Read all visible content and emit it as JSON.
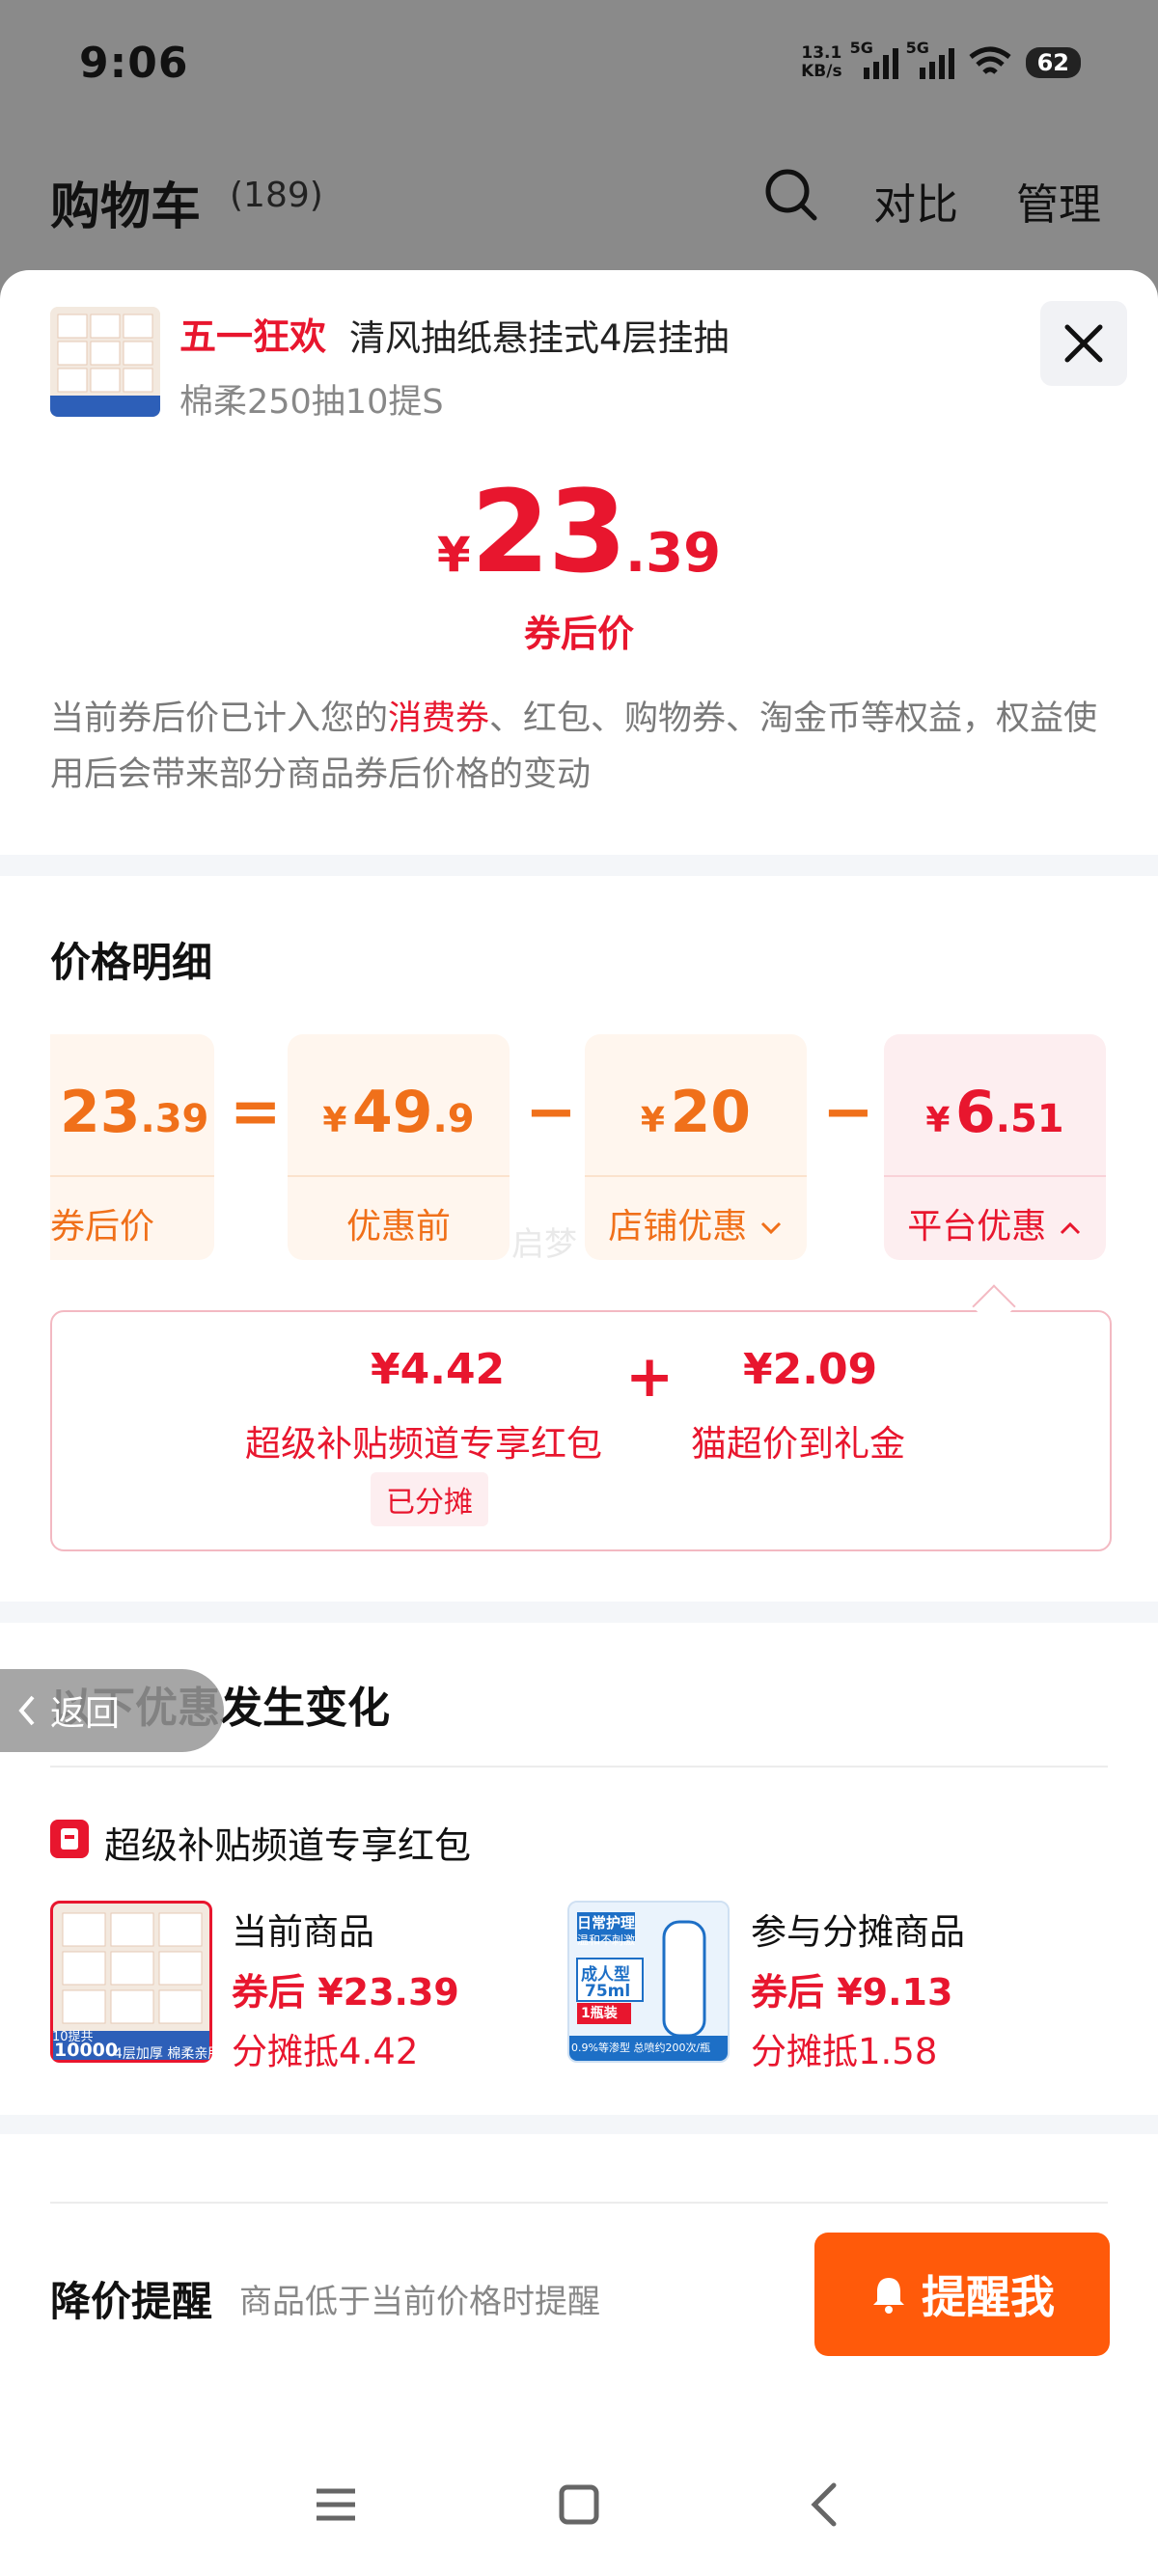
{
  "status_bar": {
    "time": "9:06",
    "net_speed_value": "13.1",
    "net_speed_unit": "KB/s",
    "sim1": "5G",
    "sim2": "5G",
    "battery": "62"
  },
  "cart_header": {
    "title": "购物车",
    "count": "(189)",
    "compare": "对比",
    "manage": "管理"
  },
  "product": {
    "tag": "五一狂欢",
    "name": "清风抽纸悬挂式4层挂抽",
    "spec": "棉柔250抽10提S",
    "thumb_badge_top": "10提共",
    "thumb_badge_num": "10000",
    "thumb_badge_text": "4层加厚 棉柔亲肤"
  },
  "price": {
    "currency": "¥",
    "integer": "23",
    "decimal": ".39",
    "label": "券后价"
  },
  "notice": {
    "part1": "当前券后价已计入您的",
    "highlight": "消费券",
    "part2": "、红包、购物券、淘金币等权益，权益使用后会带来部分商品券后价格的变动"
  },
  "detail": {
    "title": "价格明细",
    "after_coupon": {
      "integer": "23",
      "decimal": ".39",
      "label": "券后价"
    },
    "equals": "=",
    "minus": "−",
    "before": {
      "currency": "¥",
      "integer": "49",
      "decimal": ".9",
      "label": "优惠前"
    },
    "store": {
      "currency": "¥",
      "integer": "20",
      "decimal": "",
      "label": "店铺优惠"
    },
    "platform": {
      "currency": "¥",
      "integer": "6",
      "decimal": ".51",
      "label": "平台优惠"
    },
    "watermark": "启梦"
  },
  "subsidy": {
    "item1_amount": "¥4.42",
    "item1_name": "超级补贴频道专享红包",
    "item1_badge": "已分摊",
    "plus": "+",
    "item2_amount": "¥2.09",
    "item2_name": "猫超价到礼金"
  },
  "changes": {
    "title": "以下优惠发生变化",
    "back_label": "返回",
    "packet_title": "超级补贴频道专享红包",
    "current": {
      "label": "当前商品",
      "price": "券后 ¥23.39",
      "share": "分摊抵4.42"
    },
    "shared": {
      "label": "参与分摊商品",
      "price": "券后 ¥9.13",
      "share": "分摊抵1.58",
      "img_top": "日常护理",
      "img_sub": "温和不刺激",
      "img_type": "成人型",
      "img_vol": "75ml",
      "img_pack": "1瓶装",
      "img_foot": "0.9%等渗型 总喷约200次/瓶"
    }
  },
  "reminder": {
    "title": "降价提醒",
    "desc": "商品低于当前价格时提醒",
    "button": "提醒我"
  },
  "colors": {
    "brand_red": "#e8162e",
    "orange": "#f0701a",
    "button_orange": "#ff5a0a"
  }
}
